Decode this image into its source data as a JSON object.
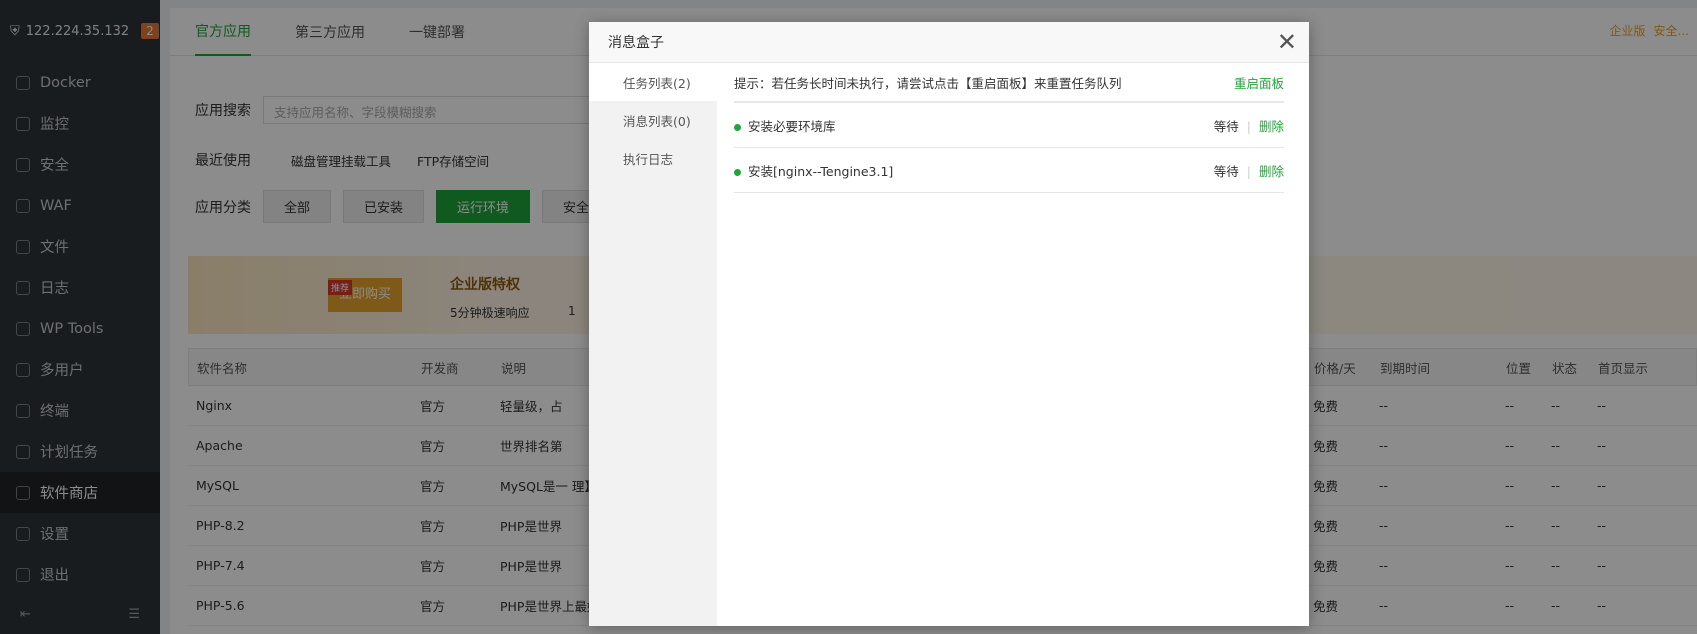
{
  "sidebar": {
    "ip": "122.224.35.132",
    "badge": "2",
    "items": [
      {
        "label": "Docker"
      },
      {
        "label": "监控"
      },
      {
        "label": "安全"
      },
      {
        "label": "WAF"
      },
      {
        "label": "文件"
      },
      {
        "label": "日志"
      },
      {
        "label": "WP Tools"
      },
      {
        "label": "多用户"
      },
      {
        "label": "终端"
      },
      {
        "label": "计划任务"
      },
      {
        "label": "软件商店"
      },
      {
        "label": "设置"
      },
      {
        "label": "退出"
      }
    ]
  },
  "main": {
    "tabs": [
      "官方应用",
      "第三方应用",
      "一键部署"
    ],
    "top_right": [
      "企业版",
      "安全..."
    ],
    "search_label": "应用搜索",
    "search_placeholder": "支持应用名称、字段模糊搜索",
    "recent_label": "最近使用",
    "recent": [
      "磁盘管理挂载工具",
      "FTP存储空间"
    ],
    "category_label": "应用分类",
    "categories": [
      "全部",
      "已安装",
      "运行环境",
      "安全应"
    ],
    "banner": {
      "buy": "立即购买",
      "tag": "推荐",
      "title": "企业版特权",
      "feature": "5分钟极速响应",
      "feature2": "1"
    },
    "columns": [
      "软件名称",
      "开发商",
      "说明",
      "价格/天",
      "到期时间",
      "位置",
      "状态",
      "首页显示"
    ],
    "rows": [
      {
        "name": "Nginx",
        "dev": "官方",
        "desc": "轻量级，占",
        "price": "免费",
        "expire": "--",
        "pos": "--",
        "status": "--",
        "home": "--"
      },
      {
        "name": "Apache",
        "dev": "官方",
        "desc": "世界排名第",
        "price": "免费",
        "expire": "--",
        "pos": "--",
        "status": "--",
        "home": "--"
      },
      {
        "name": "MySQL",
        "dev": "官方",
        "desc": "MySQL是一 理】插件",
        "price": "免费",
        "expire": "--",
        "pos": "--",
        "status": "--",
        "home": "--"
      },
      {
        "name": "PHP-8.2",
        "dev": "官方",
        "desc": "PHP是世界",
        "price": "免费",
        "expire": "--",
        "pos": "--",
        "status": "--",
        "home": "--"
      },
      {
        "name": "PHP-7.4",
        "dev": "官方",
        "desc": "PHP是世界",
        "price": "免费",
        "expire": "--",
        "pos": "--",
        "status": "--",
        "home": "--"
      },
      {
        "name": "PHP-5.6",
        "dev": "官方",
        "desc": "PHP是世界上最好的编程语言",
        "price": "免费",
        "expire": "--",
        "pos": "--",
        "status": "--",
        "home": "--"
      }
    ]
  },
  "modal": {
    "title": "消息盒子",
    "tabs": [
      "任务列表(2)",
      "消息列表(0)",
      "执行日志"
    ],
    "tip": "提示：若任务长时间未执行，请尝试点击【重启面板】来重置任务队列",
    "restart": "重启面板",
    "tasks": [
      {
        "name": "安装必要环境库",
        "status": "等待",
        "action": "删除"
      },
      {
        "name": "安装[nginx--Tengine3.1]",
        "status": "等待",
        "action": "删除"
      }
    ]
  }
}
